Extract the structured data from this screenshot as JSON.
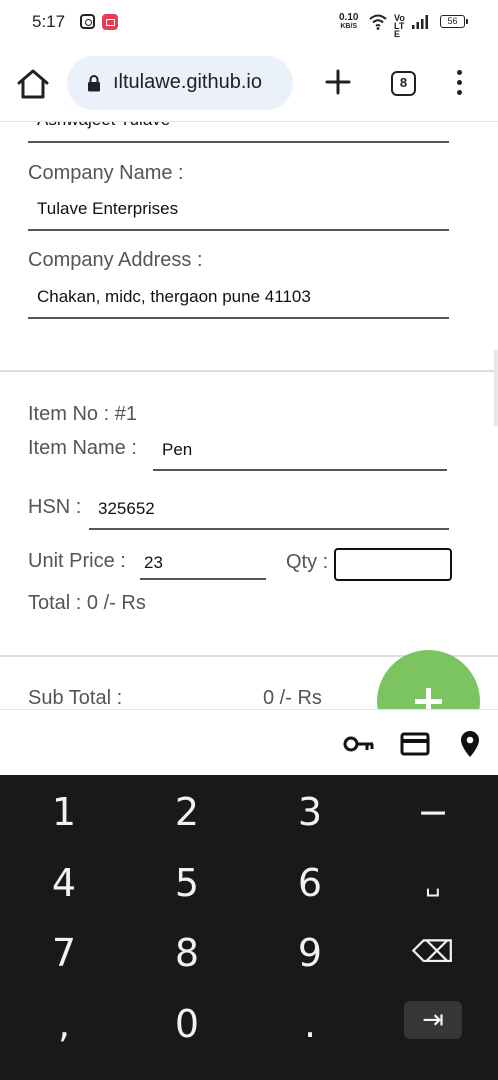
{
  "status_bar": {
    "time": "5:17",
    "net_speed_value": "0.10",
    "net_speed_unit": "KB/S",
    "volte": "Vo LTE",
    "battery": "56"
  },
  "browser": {
    "url": "ıltulawe.github.io",
    "tab_count": "8"
  },
  "form": {
    "owner_name_partial": "Ashwajeet Tulave",
    "company_name_label": "Company Name :",
    "company_name_value": "Tulave Enterprises",
    "company_address_label": "Company Address :",
    "company_address_value": "Chakan, midc, thergaon pune 41103"
  },
  "item": {
    "item_no_label": "Item No : #1",
    "item_name_label": "Item Name :",
    "item_name_value": "Pen",
    "hsn_label": "HSN :",
    "hsn_value": "325652",
    "unit_price_label": "Unit Price :",
    "unit_price_value": "23",
    "qty_label": "Qty :",
    "qty_value": "",
    "total_label": "Total : 0 /- Rs"
  },
  "summary": {
    "sub_total_label": "Sub Total :",
    "sub_total_value": "0 /- Rs"
  },
  "autofill": {
    "icons": [
      "key-icon",
      "card-icon",
      "location-icon"
    ]
  },
  "keyboard": {
    "keys": [
      "1",
      "2",
      "3",
      "−",
      "4",
      "5",
      "6",
      "␣",
      "7",
      "8",
      "9",
      "⌫",
      ",",
      "0",
      ".",
      "⇥"
    ]
  },
  "colors": {
    "fab": "#7cc462",
    "url_pill": "#eaf1fb",
    "keyboard_bg": "#191919",
    "record_icon": "#e53e52"
  }
}
